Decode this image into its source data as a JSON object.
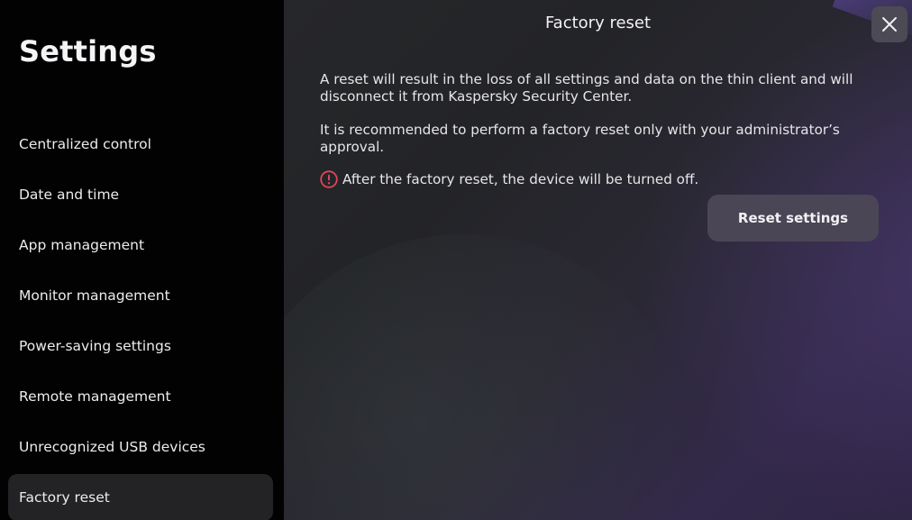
{
  "sidebar": {
    "title": "Settings",
    "items": [
      {
        "label": "Centralized control"
      },
      {
        "label": "Date and time"
      },
      {
        "label": "App management"
      },
      {
        "label": "Monitor management"
      },
      {
        "label": "Power-saving settings"
      },
      {
        "label": "Remote management"
      },
      {
        "label": "Unrecognized USB devices"
      },
      {
        "label": "Factory reset",
        "active": true
      }
    ]
  },
  "main": {
    "title": "Factory reset",
    "close_icon": "close-icon",
    "paragraph1": "A reset will result in the loss of all settings and data on the thin client and will disconnect it from Kaspersky Security Center.",
    "paragraph2": "It is recommended to perform a factory reset only with your administrator’s approval.",
    "warning_icon": "exclamation-circle-icon",
    "warning_text": "After the factory reset, the device will be turned off.",
    "reset_button_label": "Reset settings"
  },
  "colors": {
    "warning": "#e0455a",
    "active_item_bg": "#232325",
    "button_bg": "#4a4656"
  }
}
